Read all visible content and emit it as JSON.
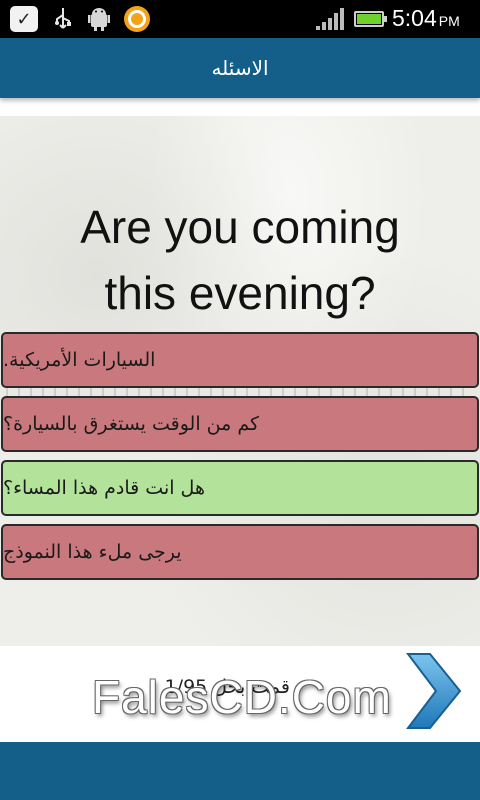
{
  "status_bar": {
    "time": "5:04",
    "ampm": "PM",
    "icons": [
      "check-icon",
      "usb-icon",
      "android-debug-icon",
      "app-notification-icon",
      "signal-icon",
      "battery-icon"
    ]
  },
  "header": {
    "title": "الاسئله"
  },
  "question": {
    "line1": "Are you coming",
    "line2": "this evening?"
  },
  "answers": [
    {
      "text": "السيارات الأمريكية.",
      "state": "wrong"
    },
    {
      "text": "كم من الوقت يستغرق بالسيارة؟",
      "state": "wrong"
    },
    {
      "text": "هل انت قادم هذا المساء؟",
      "state": "correct"
    },
    {
      "text": "يرجى ملء هذا النموذج",
      "state": "wrong"
    }
  ],
  "progress": {
    "text": "قمت بحل 1/95"
  },
  "watermark": "FalesCD.Com",
  "colors": {
    "header": "#135f8a",
    "wrong_answer": "#c9797d",
    "correct_answer": "#b3e39a",
    "next_arrow": "#3a9ad9"
  }
}
